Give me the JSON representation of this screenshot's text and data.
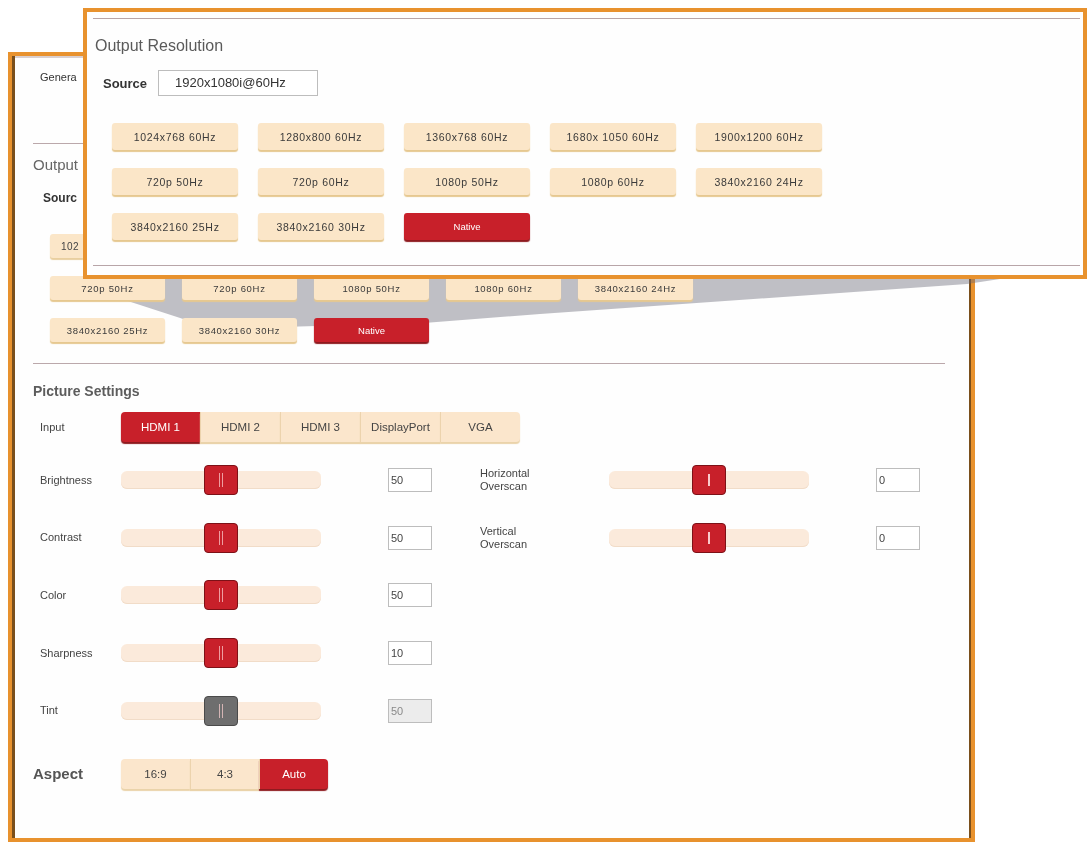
{
  "background_panel": {
    "tab": {
      "label": "Genera"
    },
    "output_resolution": {
      "title": "Output",
      "source_label": "Sourc",
      "cut_button": {
        "label": "102",
        "selected": false
      },
      "button_rows": [
        [
          {
            "label": "720p 50Hz",
            "selected": false
          },
          {
            "label": "720p 60Hz",
            "selected": false
          },
          {
            "label": "1080p 50Hz",
            "selected": false
          },
          {
            "label": "1080p 60Hz",
            "selected": false
          },
          {
            "label": "3840x2160 24Hz",
            "selected": false
          }
        ],
        [
          {
            "label": "3840x2160 25Hz",
            "selected": false
          },
          {
            "label": "3840x2160 30Hz",
            "selected": false
          },
          {
            "label": "Native",
            "selected": true
          }
        ]
      ]
    },
    "picture_settings": {
      "title": "Picture Settings",
      "input": {
        "label": "Input",
        "options": [
          {
            "label": "HDMI 1",
            "selected": true
          },
          {
            "label": "HDMI 2",
            "selected": false
          },
          {
            "label": "HDMI 3",
            "selected": false
          },
          {
            "label": "DisplayPort",
            "selected": false
          },
          {
            "label": "VGA",
            "selected": false
          }
        ]
      },
      "sliders": [
        {
          "label": "Brightness",
          "level": 0.5,
          "value": "50",
          "disabled": false
        },
        {
          "label": "Contrast",
          "level": 0.5,
          "value": "50",
          "disabled": false
        },
        {
          "label": "Color",
          "level": 0.5,
          "value": "50",
          "disabled": false
        },
        {
          "label": "Sharpness",
          "level": 0.5,
          "value": "10",
          "disabled": false
        },
        {
          "label": "Tint",
          "level": 0.5,
          "value": "50",
          "disabled": true
        }
      ],
      "overscan_sliders": [
        {
          "label": "Horizontal Overscan",
          "level": 0.5,
          "value": "0",
          "disabled": false
        },
        {
          "label": "Vertical Overscan",
          "level": 0.5,
          "value": "0",
          "disabled": false
        }
      ],
      "aspect": {
        "label": "Aspect",
        "options": [
          {
            "label": "16:9",
            "selected": false
          },
          {
            "label": "4:3",
            "selected": false
          },
          {
            "label": "Auto",
            "selected": true
          }
        ]
      }
    }
  },
  "zoom_callout": {
    "title": "Output Resolution",
    "source_label": "Source",
    "source_value": "1920x1080i@60Hz",
    "buttons": [
      {
        "label": "1024x768 60Hz",
        "selected": false
      },
      {
        "label": "1280x800 60Hz",
        "selected": false
      },
      {
        "label": "1360x768 60Hz",
        "selected": false
      },
      {
        "label": "1680x 1050 60Hz",
        "selected": false
      },
      {
        "label": "1900x1200 60Hz",
        "selected": false
      },
      {
        "label": "720p 50Hz",
        "selected": false
      },
      {
        "label": "720p 60Hz",
        "selected": false
      },
      {
        "label": "1080p 50Hz",
        "selected": false
      },
      {
        "label": "1080p 60Hz",
        "selected": false
      },
      {
        "label": "3840x2160 24Hz",
        "selected": false
      },
      {
        "label": "3840x2160 25Hz",
        "selected": false
      },
      {
        "label": "3840x2160 30Hz",
        "selected": false
      },
      {
        "label": "Native",
        "selected": true
      }
    ]
  }
}
